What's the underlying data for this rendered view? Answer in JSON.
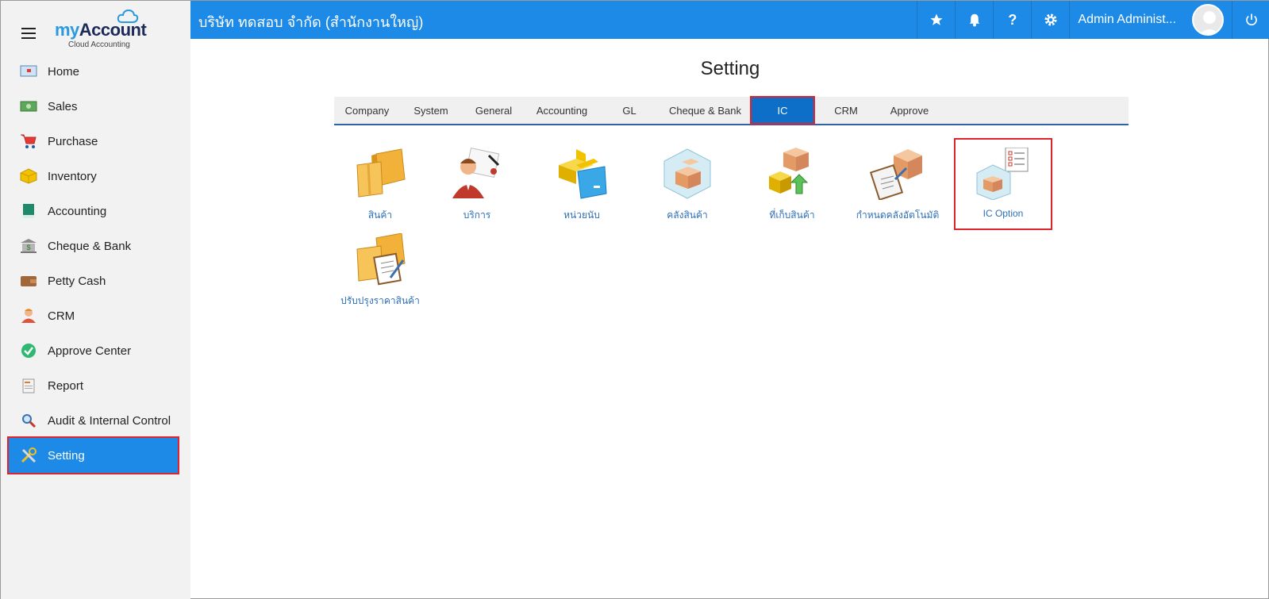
{
  "logo": {
    "brand_my": "my",
    "brand_account": "Account",
    "tagline": "Cloud Accounting"
  },
  "topbar": {
    "company": "บริษัท ทดสอบ จำกัด (สำนักงานใหญ่)",
    "user_name": "Admin Administ..."
  },
  "sidebar": {
    "items": [
      {
        "label": "Home",
        "icon": "home-icon"
      },
      {
        "label": "Sales",
        "icon": "cash-icon"
      },
      {
        "label": "Purchase",
        "icon": "cart-icon"
      },
      {
        "label": "Inventory",
        "icon": "box-icon"
      },
      {
        "label": "Accounting",
        "icon": "book-icon"
      },
      {
        "label": "Cheque & Bank",
        "icon": "bank-icon"
      },
      {
        "label": "Petty Cash",
        "icon": "wallet-icon"
      },
      {
        "label": "CRM",
        "icon": "person-icon"
      },
      {
        "label": "Approve Center",
        "icon": "check-circle-icon"
      },
      {
        "label": "Report",
        "icon": "report-icon"
      },
      {
        "label": "Audit & Internal Control",
        "icon": "magnifier-icon"
      },
      {
        "label": "Setting",
        "icon": "tools-icon",
        "active": true
      }
    ]
  },
  "main": {
    "title": "Setting",
    "tabs": [
      {
        "label": "Company"
      },
      {
        "label": "System"
      },
      {
        "label": "General"
      },
      {
        "label": "Accounting"
      },
      {
        "label": "GL"
      },
      {
        "label": "Cheque & Bank"
      },
      {
        "label": "IC",
        "active": true
      },
      {
        "label": "CRM"
      },
      {
        "label": "Approve"
      }
    ],
    "tiles": [
      {
        "label": "สินค้า",
        "icon": "product-boxes-icon"
      },
      {
        "label": "บริการ",
        "icon": "service-person-icon"
      },
      {
        "label": "หน่วยนับ",
        "icon": "unit-folder-icon"
      },
      {
        "label": "คลังสินค้า",
        "icon": "warehouse-icon"
      },
      {
        "label": "ที่เก็บสินค้า",
        "icon": "storage-location-icon"
      },
      {
        "label": "กำหนดคลังอัตโนมัติ",
        "icon": "auto-warehouse-icon"
      },
      {
        "label": "IC Option",
        "icon": "ic-option-icon",
        "highlight": true
      },
      {
        "label": "ปรับปรุงราคาสินค้า",
        "icon": "price-adjust-icon"
      }
    ]
  },
  "colors": {
    "primary": "#1c8ae6",
    "highlight": "#e0232c",
    "tab_active": "#0e6fc8",
    "link": "#2d6fb8"
  }
}
